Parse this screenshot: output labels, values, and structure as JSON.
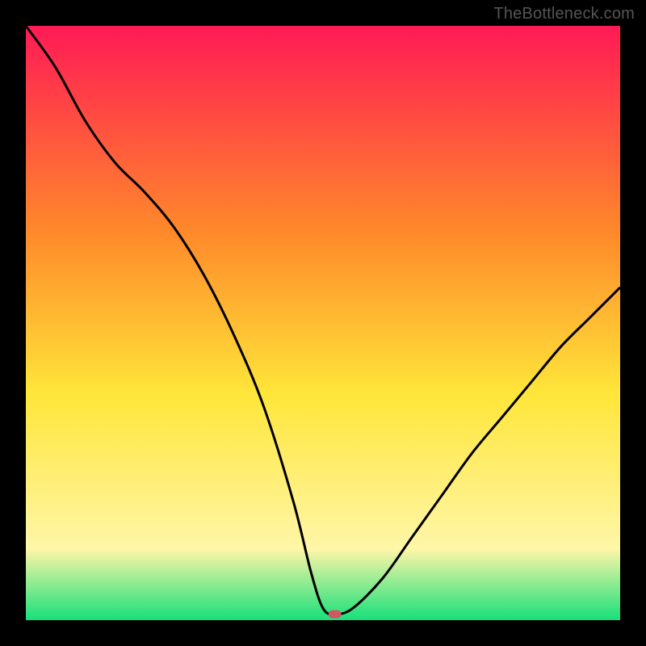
{
  "watermark": "TheBottleneck.com",
  "colors": {
    "bg": "#000000",
    "top": "#ff1a55",
    "mid1": "#ff8a2a",
    "mid2": "#ffe63a",
    "mid3": "#fff6a8",
    "bottom": "#17e07a",
    "curve": "#000000",
    "marker": "#d2555f"
  },
  "chart_data": {
    "type": "line",
    "title": "",
    "xlabel": "",
    "ylabel": "",
    "xlim": [
      0,
      100
    ],
    "ylim": [
      0,
      100
    ],
    "grid": false,
    "legend": false,
    "annotations": [
      {
        "kind": "marker",
        "x": 52,
        "y": 1
      }
    ],
    "series": [
      {
        "name": "bottleneck-curve",
        "x": [
          0,
          5,
          10,
          15,
          20,
          25,
          30,
          35,
          40,
          45,
          48,
          50,
          52,
          55,
          60,
          65,
          70,
          75,
          80,
          85,
          90,
          95,
          100
        ],
        "y": [
          100,
          93,
          84,
          77,
          72,
          66,
          58,
          48,
          36,
          20,
          8,
          2,
          1,
          2,
          7,
          14,
          21,
          28,
          34,
          40,
          46,
          51,
          56
        ]
      }
    ]
  }
}
